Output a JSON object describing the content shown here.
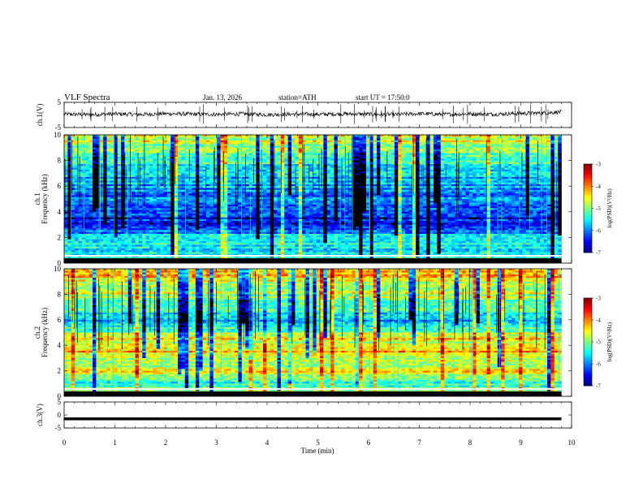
{
  "header": {
    "title": "VLF Spectra",
    "date": "Jan. 13, 2026",
    "station": "station=ATH",
    "start_ut": "start UT = 17:50:0"
  },
  "chart_data": [
    {
      "type": "line",
      "name": "ch1-waveform",
      "ylabel": "ch.1(V)",
      "ylim": [
        -5,
        5
      ],
      "yticks": [
        "5",
        "-5"
      ],
      "x": [
        0,
        0.5,
        1,
        1.5,
        2,
        2.5,
        3,
        3.5,
        4,
        4.5,
        5,
        5.5,
        6,
        6.5,
        7,
        7.5,
        8,
        8.5,
        9,
        9.5,
        9.8
      ],
      "y": [
        0.3,
        0.1,
        0.4,
        0.2,
        0.5,
        0.3,
        0.2,
        0.4,
        0.1,
        0.3,
        0.2,
        0.4,
        0.3,
        0.1,
        0.5,
        0.2,
        0.4,
        0.3,
        0.6,
        0.8,
        1.2
      ]
    },
    {
      "type": "heatmap",
      "name": "ch1-spectrogram",
      "ylabel": "ch.1 Frequency (kHz)",
      "ylim": [
        0,
        10
      ],
      "yticks": [
        "0",
        "2",
        "4",
        "6",
        "8",
        "10"
      ],
      "xlim": [
        0,
        9.8
      ],
      "colorbar": {
        "label": "log(PSD)(V²/Hz)",
        "ticks": [
          "-3",
          "-4",
          "-5",
          "-6",
          "-7"
        ],
        "range": [
          -7,
          -3
        ]
      },
      "profile": {
        "freq_khz": [
          0,
          0.5,
          1,
          1.5,
          2,
          2.5,
          3,
          3.5,
          4,
          4.5,
          5,
          5.5,
          6,
          6.5,
          7,
          7.5,
          8,
          8.5,
          9,
          9.5,
          10
        ],
        "log_psd": [
          -5.0,
          -5.3,
          -5.6,
          -5.5,
          -5.3,
          -6.2,
          -6.4,
          -6.5,
          -6.3,
          -6.1,
          -6.0,
          -5.9,
          -5.8,
          -5.7,
          -5.6,
          -5.5,
          -5.3,
          -5.1,
          -4.9,
          -4.7,
          -4.5
        ]
      }
    },
    {
      "type": "heatmap",
      "name": "ch2-spectrogram",
      "ylabel": "ch.2 Frequency (kHz)",
      "ylim": [
        0,
        10
      ],
      "yticks": [
        "0",
        "2",
        "4",
        "6",
        "8",
        "10"
      ],
      "xlim": [
        0,
        9.8
      ],
      "colorbar": {
        "label": "log(PSD)(V²/Hz)",
        "ticks": [
          "-3",
          "-4",
          "-5",
          "-6",
          "-7"
        ],
        "range": [
          -7,
          -3
        ]
      },
      "profile": {
        "freq_khz": [
          0,
          0.5,
          1,
          1.5,
          2,
          2.5,
          3,
          3.5,
          4,
          4.5,
          5,
          5.5,
          6,
          6.5,
          7,
          7.5,
          8,
          8.5,
          9,
          9.5,
          10
        ],
        "log_psd": [
          -4.9,
          -5.0,
          -5.2,
          -5.1,
          -4.2,
          -5.0,
          -4.9,
          -4.2,
          -4.8,
          -4.4,
          -5.0,
          -5.6,
          -5.8,
          -5.5,
          -5.3,
          -5.0,
          -4.8,
          -4.6,
          -4.5,
          -4.3,
          -4.2
        ]
      }
    },
    {
      "type": "line",
      "name": "ch3-waveform",
      "ylabel": "ch.3(V)",
      "ylim": [
        -5,
        5
      ],
      "yticks": [
        "5",
        "0",
        "-5"
      ],
      "x": [
        0,
        9.8
      ],
      "y": [
        -1.5,
        -1.5
      ]
    }
  ],
  "xaxis": {
    "label": "Time (min)",
    "ticks": [
      "0",
      "1",
      "2",
      "3",
      "4",
      "5",
      "6",
      "7",
      "8",
      "9",
      "10"
    ],
    "xlim": [
      0,
      10
    ]
  },
  "colors": {
    "waveform": "#000000",
    "frame": "#000000"
  }
}
